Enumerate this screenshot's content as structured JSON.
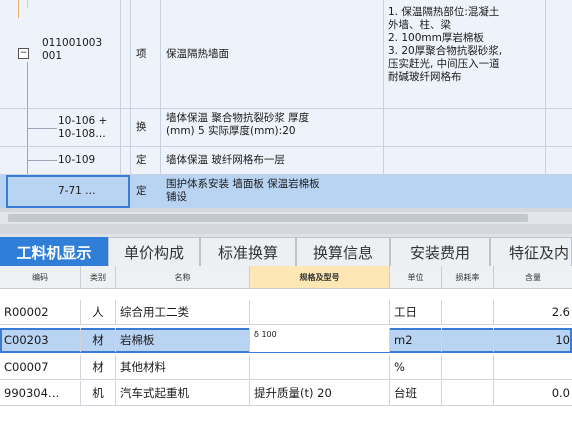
{
  "upper_tree": {
    "rows": [
      {
        "code": "",
        "type": "",
        "name": "",
        "features": ""
      },
      {
        "code_line1": "011001003",
        "code_line2": "001",
        "type": "项",
        "name": "保温隔热墙面",
        "features": [
          "1. 保温隔热部位:混凝土",
          "外墙、柱、梁",
          "2. 100mm厚岩棉板",
          "3. 20厚聚合物抗裂砂浆,",
          "压实赶光, 中间压入一道",
          "耐碱玻纤网格布"
        ]
      },
      {
        "code_line1": "10-106 +",
        "code_line2": "10-108…",
        "type": "换",
        "name_line1": "墙体保温 聚合物抗裂砂浆 厚度",
        "name_line2": "(mm) 5  实际厚度(mm):20"
      },
      {
        "code": "10-109",
        "type": "定",
        "name": "墙体保温 玻纤网格布一层"
      },
      {
        "code": "7-71  …",
        "type": "定",
        "name_line1": "围护体系安装 墙面板 保温岩棉板",
        "name_line2": "铺设"
      }
    ]
  },
  "tabs": [
    {
      "label": "工料机显示",
      "active": true
    },
    {
      "label": "单价构成",
      "active": false
    },
    {
      "label": "标准换算",
      "active": false
    },
    {
      "label": "换算信息",
      "active": false
    },
    {
      "label": "安装费用",
      "active": false
    },
    {
      "label": "特征及内",
      "active": false
    }
  ],
  "lower_table": {
    "headers": {
      "code": "编码",
      "category": "类别",
      "name": "名称",
      "spec": "规格及型号",
      "unit": "单位",
      "loss": "损耗率",
      "qty": "含量"
    },
    "rows": [
      {
        "code": "R00002",
        "category": "人",
        "name": "综合用工二类",
        "spec": "",
        "unit": "工日",
        "loss": "",
        "qty": "2.6"
      },
      {
        "code": "C00203",
        "category": "材",
        "name": "岩棉板",
        "spec": "δ 100",
        "unit": "m2",
        "loss": "",
        "qty": "10"
      },
      {
        "code": "C00007",
        "category": "材",
        "name": "其他材料",
        "spec": "",
        "unit": "%",
        "loss": "",
        "qty": ""
      },
      {
        "code": "990304…",
        "category": "机",
        "name": "汽车式起重机",
        "spec": "提升质量(t) 20",
        "unit": "台班",
        "loss": "",
        "qty": "0.0"
      }
    ]
  },
  "colors": {
    "tab_active_bg": "#2f7fd8",
    "selected_row_bg": "#b9d3f3",
    "selected_row_border": "#3a7bd5",
    "spec_header_bg": "#fde7b4",
    "tree_line": "#e0b06a"
  }
}
